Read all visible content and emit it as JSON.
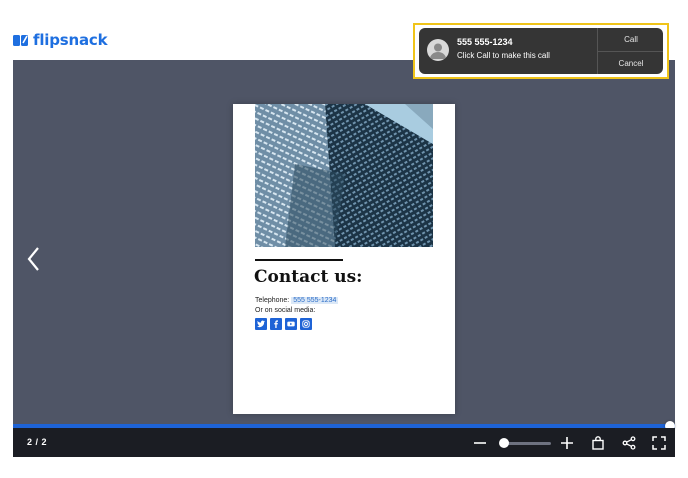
{
  "brand": {
    "logo_text": "flipsnack"
  },
  "viewer": {
    "page_indicator": "2 / 2",
    "progress_fraction": 1.0,
    "zoom_fraction": 0.0
  },
  "page": {
    "heading": "Contact us:",
    "telephone_label": "Telephone:",
    "telephone_value": "555 555-1234",
    "social_label": "Or on social media:",
    "socials": [
      "twitter-icon",
      "facebook-icon",
      "youtube-icon",
      "instagram-icon"
    ]
  },
  "toolbar": {
    "icons": [
      "zoom-out-icon",
      "zoom-in-icon",
      "shopping-bag-icon",
      "share-icon",
      "fullscreen-icon"
    ]
  },
  "call_prompt": {
    "number": "555 555-1234",
    "message": "Click Call to make this call",
    "call_label": "Call",
    "cancel_label": "Cancel"
  },
  "colors": {
    "brand_blue": "#1e6fe0",
    "stage": "#4f5566",
    "toolbar": "#1b1d23",
    "highlight": "#f0c419"
  }
}
